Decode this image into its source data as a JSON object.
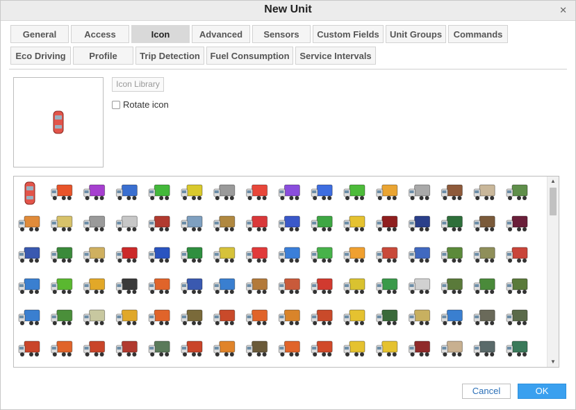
{
  "dialog": {
    "title": "New Unit"
  },
  "tabs_row1": [
    {
      "label": "General"
    },
    {
      "label": "Access"
    },
    {
      "label": "Icon",
      "active": true
    },
    {
      "label": "Advanced"
    },
    {
      "label": "Sensors"
    },
    {
      "label": "Custom Fields"
    },
    {
      "label": "Unit Groups"
    },
    {
      "label": "Commands"
    }
  ],
  "tabs_row2": [
    {
      "label": "Eco Driving"
    },
    {
      "label": "Profile"
    },
    {
      "label": "Trip Detection"
    },
    {
      "label": "Fuel Consumption"
    },
    {
      "label": "Service Intervals"
    }
  ],
  "icon_panel": {
    "library_button": "Icon Library",
    "rotate_label": "Rotate icon",
    "rotate_checked": false
  },
  "buttons": {
    "cancel": "Cancel",
    "ok": "OK"
  },
  "icon_rows": [
    [
      "#e2544a",
      "#e8542a",
      "#a63fcf",
      "#3a6fd0",
      "#43b83a",
      "#d9c92d",
      "#9a9a9a",
      "#e8473a",
      "#8a4ddd",
      "#3e6de0",
      "#4dbb3a",
      "#eaa533",
      "#a9a9a9",
      "#8e5a3a",
      "#c9b79a",
      "#5f8f4a"
    ],
    [
      "#e08b3a",
      "#d7c26a",
      "#9a9a9a",
      "#c7c7c7",
      "#b13a2f",
      "#7fa0c0",
      "#b08840",
      "#d9383a",
      "#3a58c9",
      "#3ea743",
      "#e5c230",
      "#8f1f1f",
      "#2a3f8a",
      "#2e6f3a",
      "#7a5a3a",
      "#6a1f3a"
    ],
    [
      "#3a59b0",
      "#3a8a3a",
      "#cfb060",
      "#cc2a2a",
      "#2a54c0",
      "#2f8f3f",
      "#d6c23a",
      "#e13a3a",
      "#3b7fd9",
      "#47b24a",
      "#f0a030",
      "#c94a3a",
      "#4169c0",
      "#5b8a3a",
      "#8f8f5a",
      "#c9453a"
    ],
    [
      "#3a7fd0",
      "#5ab830",
      "#e2a828",
      "#3a3a3a",
      "#e0642a",
      "#3a59b0",
      "#3a7fd0",
      "#b37a3a",
      "#c95a3a",
      "#d13a2f",
      "#d9c230",
      "#3a9a4a",
      "#d1d1d1",
      "#5a7a3a",
      "#4a8a3a",
      "#5a7a3a"
    ],
    [
      "#3a7fd0",
      "#4a8f3a",
      "#c8c8a0",
      "#e0a82a",
      "#e0642a",
      "#7a6a3a",
      "#c94a2a",
      "#e0642a",
      "#d9842a",
      "#c94a2a",
      "#e5c230",
      "#3a6a3a",
      "#c8b060",
      "#3a7fd0",
      "#6a6a5a",
      "#5a6a4a"
    ],
    [
      "#c9452a",
      "#e0642a",
      "#c9452a",
      "#b13a2f",
      "#5a7a5a",
      "#c9452a",
      "#e0842a",
      "#6a5a3a",
      "#e0642a",
      "#d14a2a",
      "#e5c230",
      "#e5c230",
      "#8f2a2a",
      "#c8b090",
      "#5a6a6a",
      "#3a7a5a"
    ]
  ]
}
